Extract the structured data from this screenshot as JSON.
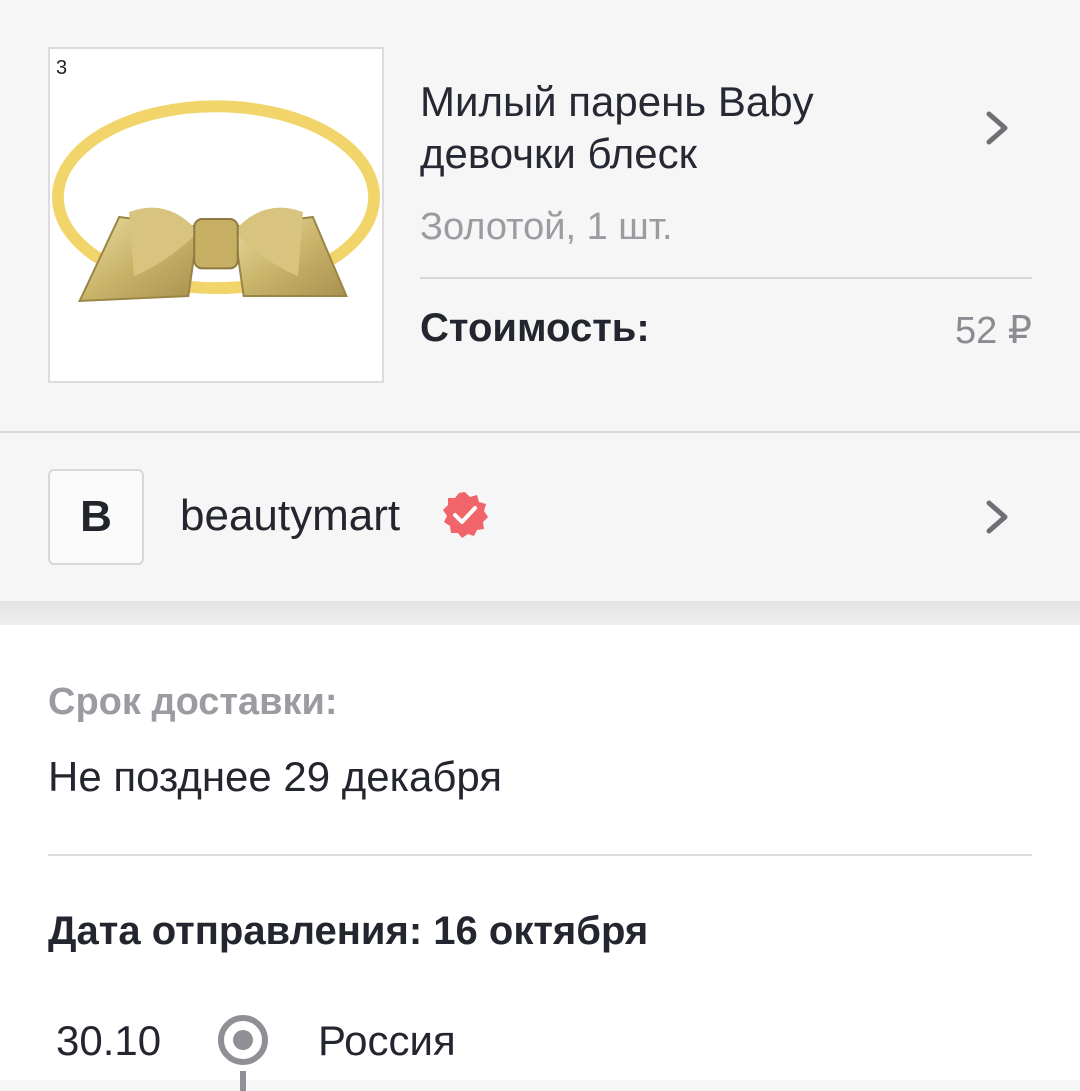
{
  "product": {
    "image_count": "3",
    "title_line1": "Милый парень Baby",
    "title_line2": "девочки блеск",
    "variant": "Золотой, 1 шт.",
    "cost_label": "Стоимость:",
    "cost_value": "52 ₽"
  },
  "seller": {
    "avatar_letter": "B",
    "name": "beautymart",
    "verified_color": "#f0646a"
  },
  "delivery": {
    "label": "Срок доставки:",
    "value": "Не позднее 29 декабря",
    "ship_date": "Дата отправления: 16 октября"
  },
  "tracking": [
    {
      "date": "30.10",
      "place": "Россия"
    }
  ]
}
